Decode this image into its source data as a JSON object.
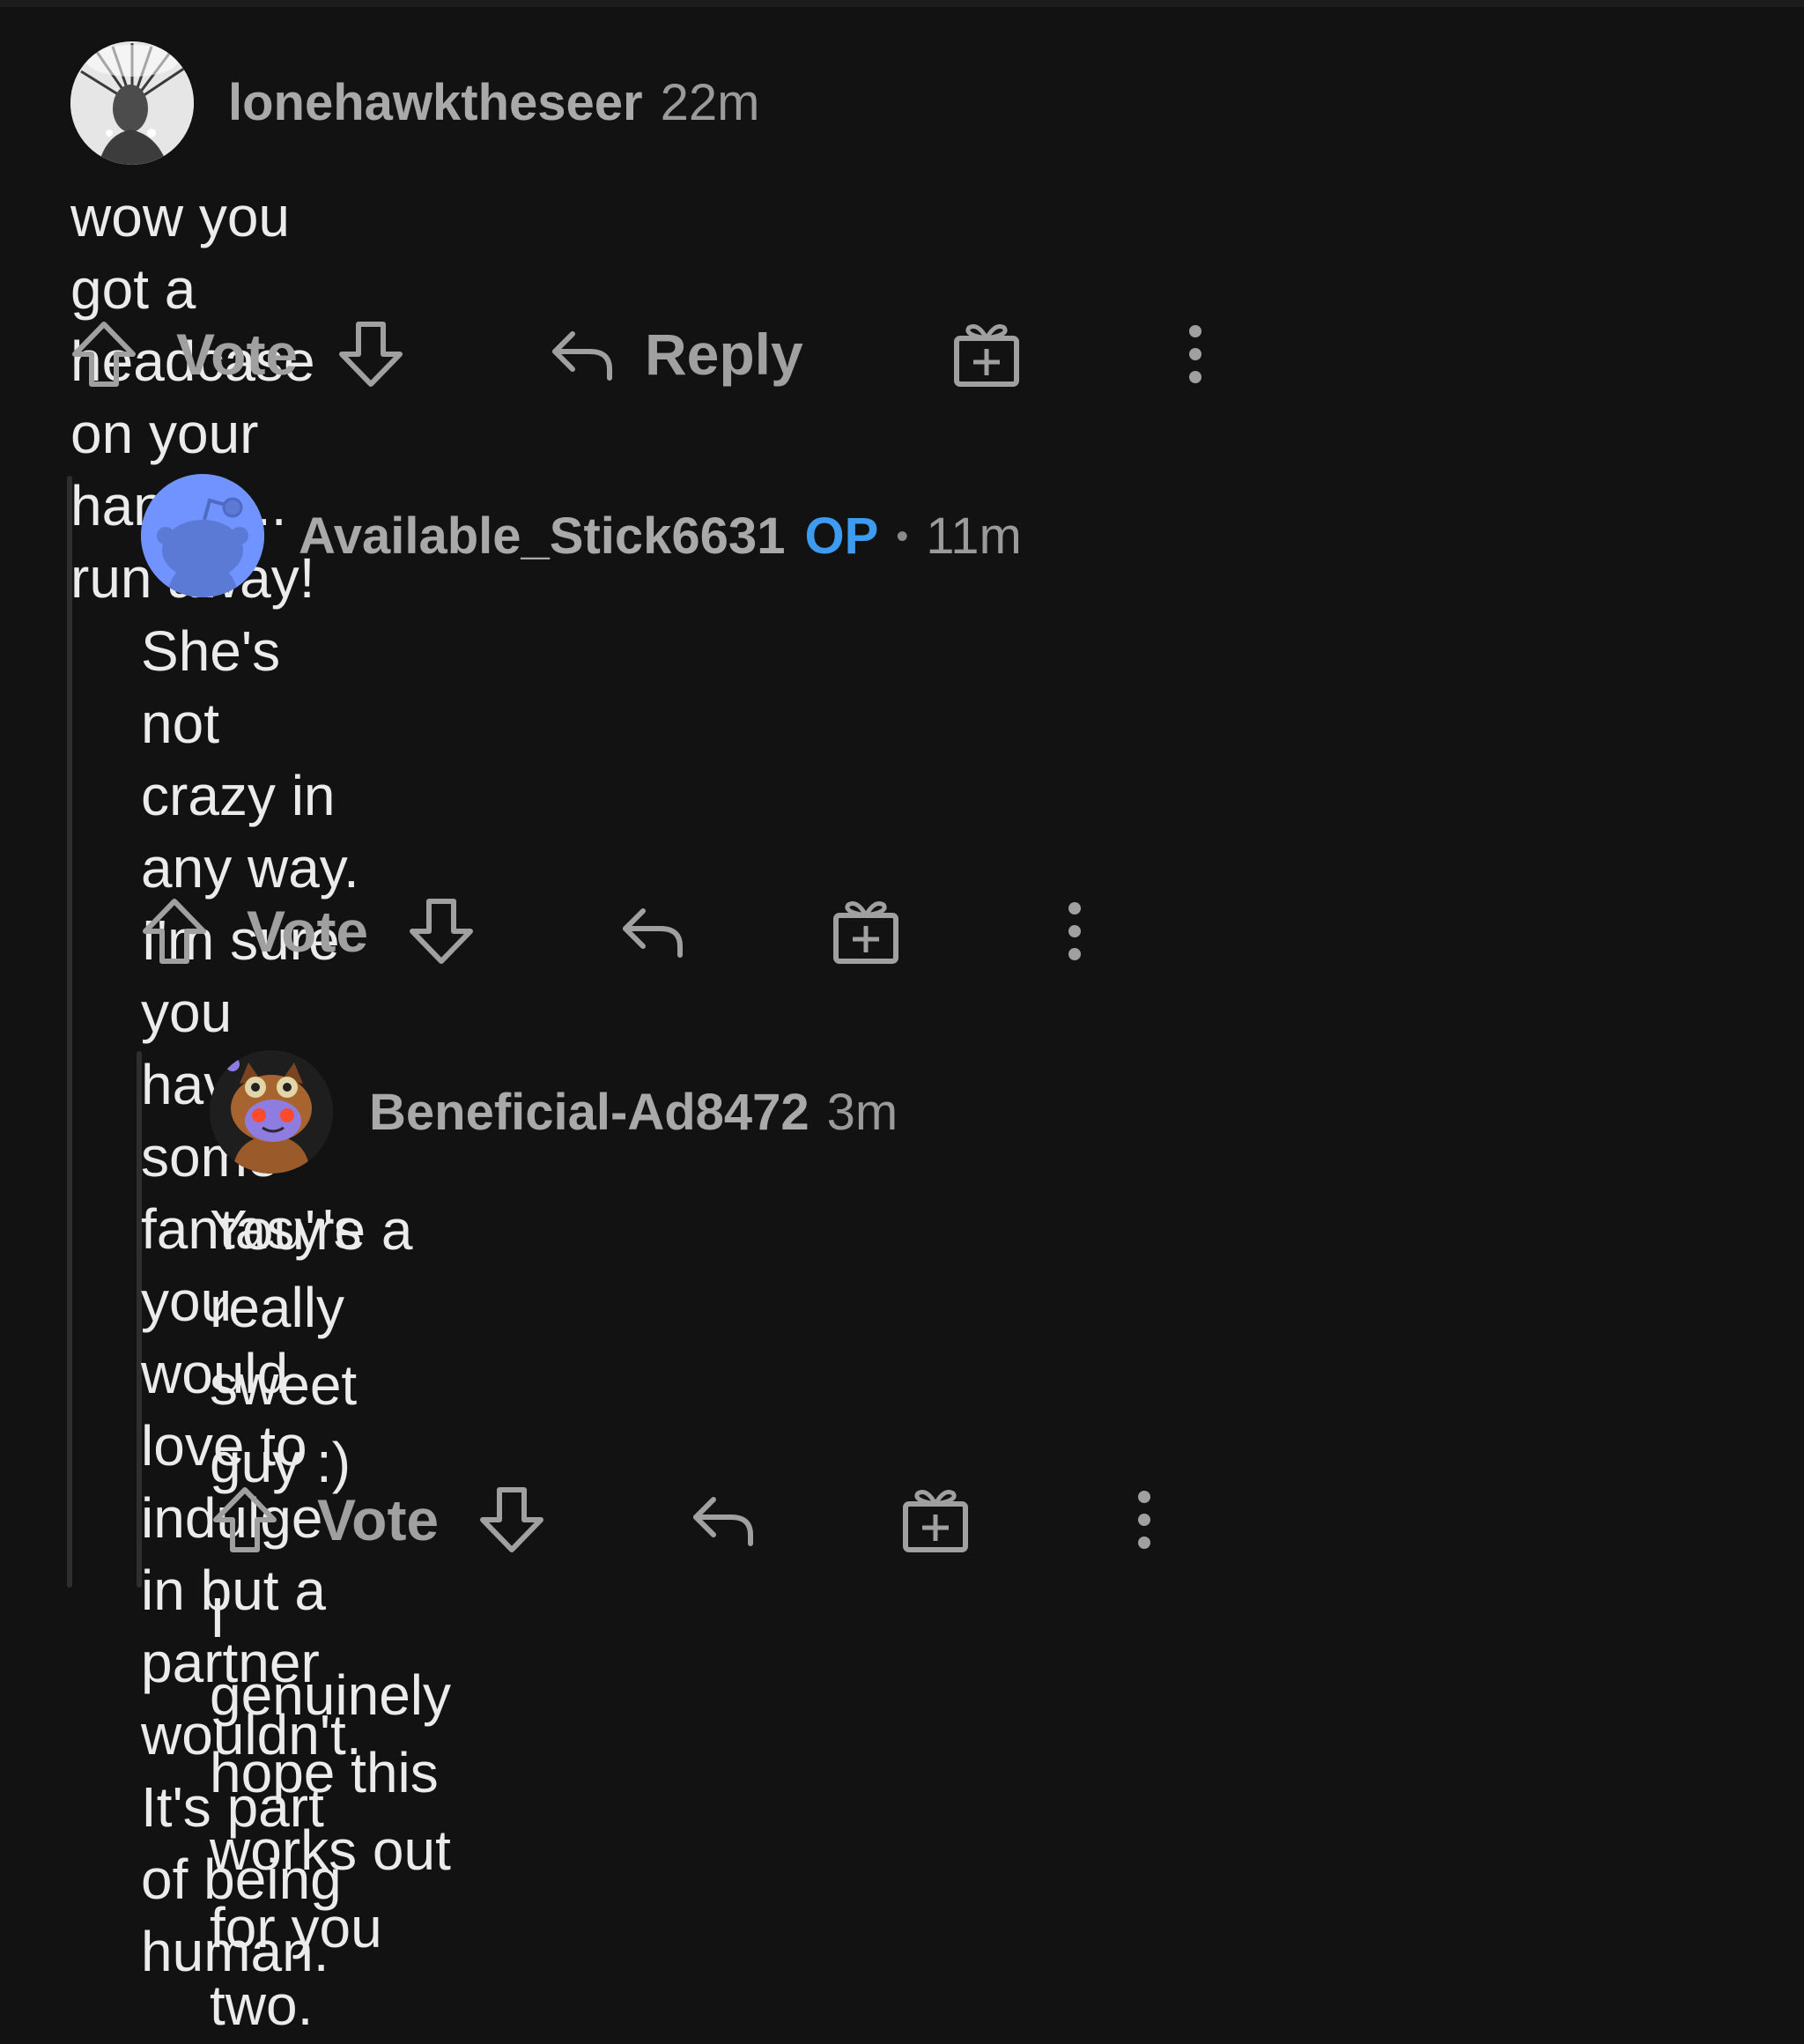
{
  "comments": [
    {
      "username": "lonehawktheseer",
      "time": "22m",
      "body": "wow you got a headcase on your hands ... run away!",
      "avatar": "portrait-avatar",
      "actions": {
        "vote_label": "Vote",
        "reply_label": "Reply"
      }
    },
    {
      "username": "Available_Stick6631",
      "badge": "OP",
      "separator": "•",
      "time": "11m",
      "body": "She's not crazy in any way. I'm sure you have some\nfantasy's you would love to indulge in but a partner\nwouldn't. It's part of being human.",
      "avatar": "snoo-avatar",
      "actions": {
        "vote_label": "Vote"
      }
    },
    {
      "username": "Beneficial-Ad8472",
      "time": "3m",
      "body": "You're a really sweet guy :)\n\nI genuinely hope this works out for you two.",
      "avatar": "owl-snoo-avatar",
      "actions": {
        "vote_label": "Vote"
      }
    }
  ],
  "icons": {
    "upvote": "upvote-arrow-icon",
    "downvote": "downvote-arrow-icon",
    "reply": "reply-arrow-icon",
    "award": "gift-award-icon",
    "more": "more-vertical-icon"
  },
  "colors": {
    "background": "#121212",
    "username": "#a9a9a9",
    "op_badge": "#3d9cf0",
    "body_text": "#ebebeb",
    "action_gray": "#a0a0a0"
  }
}
